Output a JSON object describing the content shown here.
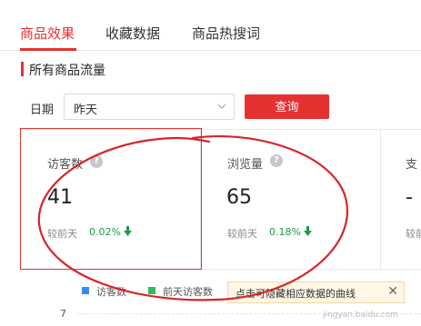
{
  "tabs": [
    {
      "label": "商品效果",
      "active": true
    },
    {
      "label": "收藏数据",
      "active": false
    },
    {
      "label": "商品热搜词",
      "active": false
    }
  ],
  "section": {
    "title": "所有商品流量"
  },
  "filter": {
    "date_label": "日期",
    "date_value": "昨天",
    "query_button": "查询"
  },
  "metrics": [
    {
      "label": "访客数",
      "value": "41",
      "compare_label": "较前天",
      "change": "0.02%",
      "trend": "down"
    },
    {
      "label": "浏览量",
      "value": "65",
      "compare_label": "较前天",
      "change": "0.18%",
      "trend": "down"
    },
    {
      "label": "支",
      "value": "-",
      "compare_label": "较前"
    }
  ],
  "chart": {
    "legend": [
      {
        "label": "访客数",
        "color": "#2f8ff0"
      },
      {
        "label": "前天访客数",
        "color": "#33b85c"
      }
    ],
    "tooltip": "点击可隐藏相应数据的曲线",
    "y_tick": "7"
  },
  "watermark": "jingyan.baidu.com",
  "colors": {
    "accent": "#e5312f",
    "trend_down": "#1e9b48",
    "annotation": "#d8242b"
  }
}
